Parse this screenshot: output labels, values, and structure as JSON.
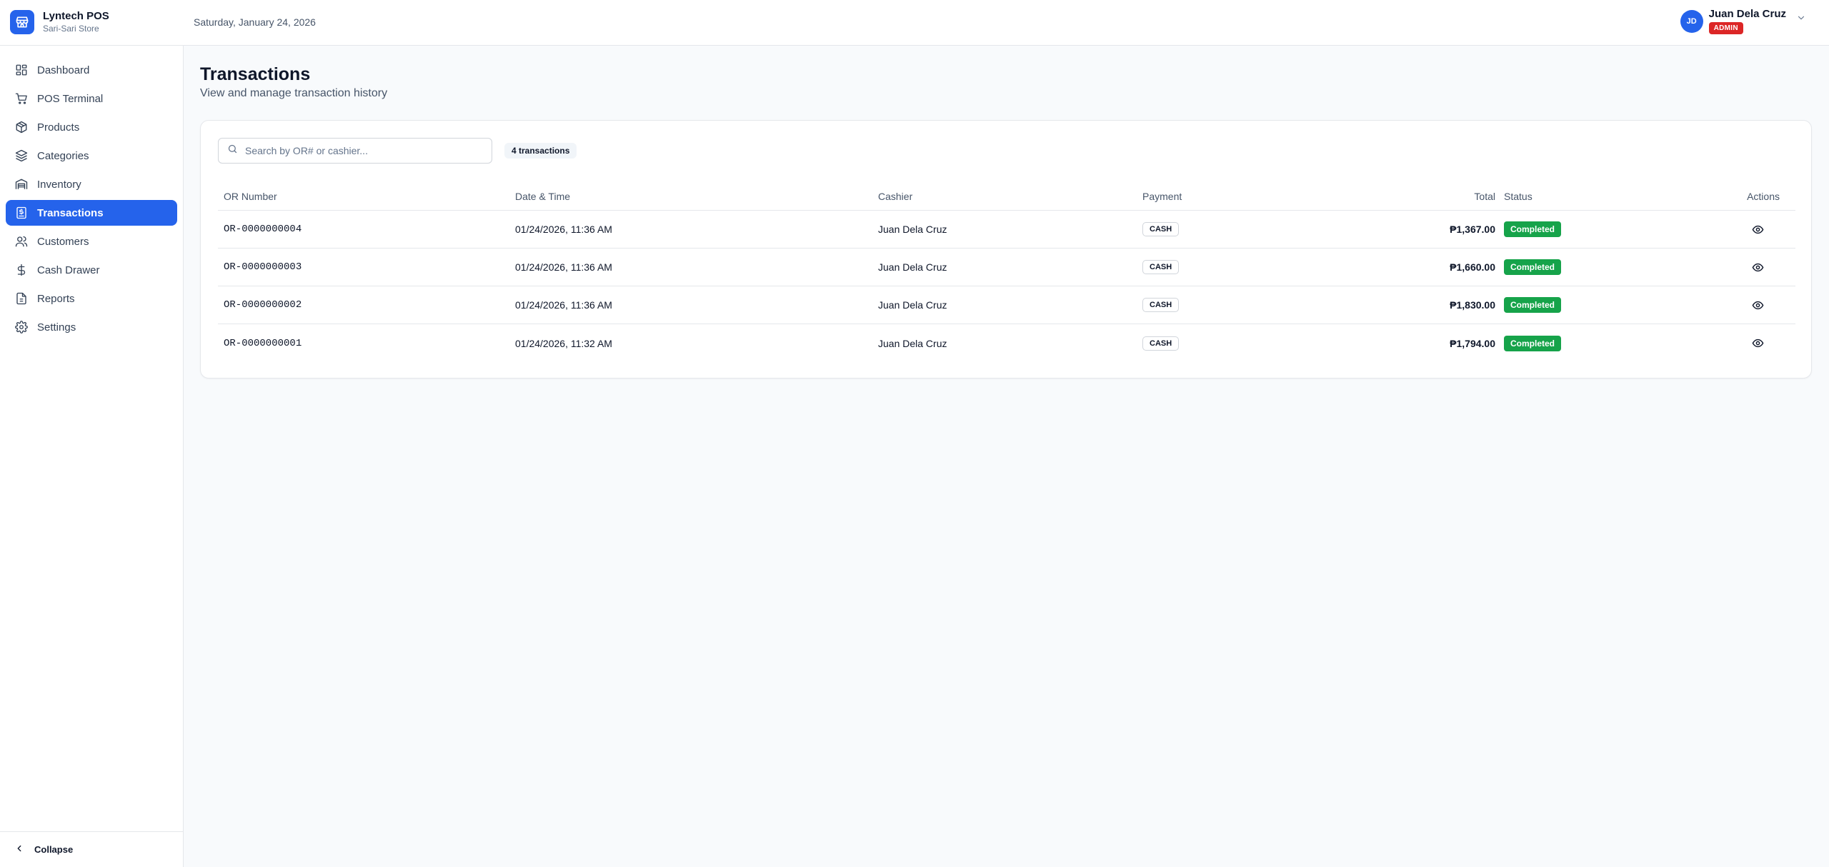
{
  "app": {
    "name": "Lyntech POS",
    "store": "Sari-Sari Store",
    "date": "Saturday, January 24, 2026"
  },
  "user": {
    "initials": "JD",
    "name": "Juan Dela Cruz",
    "role": "ADMIN"
  },
  "sidebar": {
    "items": [
      {
        "label": "Dashboard",
        "icon": "dashboard-icon"
      },
      {
        "label": "POS Terminal",
        "icon": "cart-icon"
      },
      {
        "label": "Products",
        "icon": "package-icon"
      },
      {
        "label": "Categories",
        "icon": "layers-icon"
      },
      {
        "label": "Inventory",
        "icon": "warehouse-icon"
      },
      {
        "label": "Transactions",
        "icon": "receipt-icon",
        "active": true
      },
      {
        "label": "Customers",
        "icon": "users-icon"
      },
      {
        "label": "Cash Drawer",
        "icon": "dollar-icon"
      },
      {
        "label": "Reports",
        "icon": "report-icon"
      },
      {
        "label": "Settings",
        "icon": "gear-icon"
      }
    ],
    "collapse_label": "Collapse"
  },
  "page": {
    "title": "Transactions",
    "subtitle": "View and manage transaction history"
  },
  "search": {
    "placeholder": "Search by OR# or cashier...",
    "value": ""
  },
  "count_badge": "4 transactions",
  "table": {
    "headers": {
      "or": "OR Number",
      "date": "Date & Time",
      "cashier": "Cashier",
      "payment": "Payment",
      "total": "Total",
      "status": "Status",
      "actions": "Actions"
    },
    "rows": [
      {
        "or": "OR-0000000004",
        "date": "01/24/2026, 11:36 AM",
        "cashier": "Juan Dela Cruz",
        "payment": "CASH",
        "total": "₱1,367.00",
        "status": "Completed"
      },
      {
        "or": "OR-0000000003",
        "date": "01/24/2026, 11:36 AM",
        "cashier": "Juan Dela Cruz",
        "payment": "CASH",
        "total": "₱1,660.00",
        "status": "Completed"
      },
      {
        "or": "OR-0000000002",
        "date": "01/24/2026, 11:36 AM",
        "cashier": "Juan Dela Cruz",
        "payment": "CASH",
        "total": "₱1,830.00",
        "status": "Completed"
      },
      {
        "or": "OR-0000000001",
        "date": "01/24/2026, 11:32 AM",
        "cashier": "Juan Dela Cruz",
        "payment": "CASH",
        "total": "₱1,794.00",
        "status": "Completed"
      }
    ]
  },
  "colors": {
    "accent": "#2563eb",
    "success": "#16a34a",
    "admin_badge": "#dc2626"
  }
}
